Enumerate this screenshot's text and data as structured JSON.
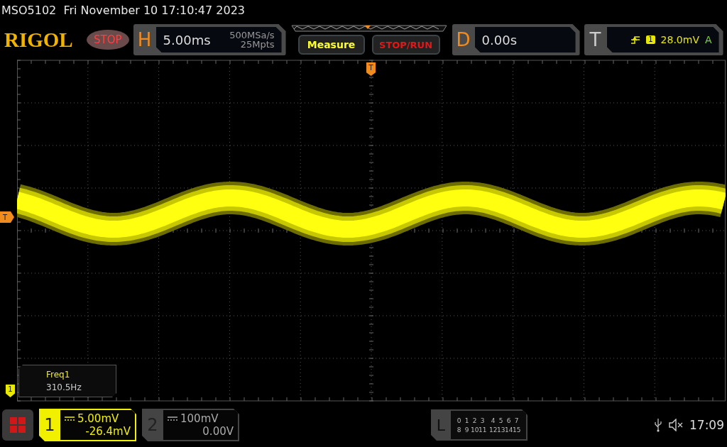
{
  "title": "MSO5102  Fri November 10 17:10:47 2023",
  "header": {
    "logo": "RIGOL",
    "run_status": "STOP",
    "horizontal": {
      "label": "H",
      "timebase": "5.00ms",
      "sample_rate": "500MSa/s",
      "memory_depth": "25Mpts"
    },
    "buttons": [
      {
        "label": "Measure",
        "kind": "measure"
      },
      {
        "label": "STOP/RUN",
        "kind": "stoprun"
      }
    ],
    "delay": {
      "label": "D",
      "value": "0.00s"
    },
    "trigger": {
      "label": "T",
      "source": "1",
      "trigger_level": "28.0mV",
      "mode": "A"
    }
  },
  "plot": {
    "trigger_marker": "T",
    "top_marker": "T",
    "channel_marker": "1",
    "measurement": {
      "name": "Freq1",
      "value": "310.5Hz"
    }
  },
  "bottom": {
    "channels": [
      {
        "number": "1",
        "scale": "5.00mV",
        "offset": "-26.4mV",
        "on": true
      },
      {
        "number": "2",
        "scale": "100mV",
        "offset": "0.00V",
        "on": false
      }
    ],
    "logic": {
      "label": "L",
      "rows": [
        [
          "0",
          "1",
          "2",
          "3",
          "4",
          "5",
          "6",
          "7"
        ],
        [
          "8",
          "9",
          "10",
          "11",
          "12",
          "13",
          "14",
          "15"
        ]
      ]
    },
    "time": "17:09"
  }
}
